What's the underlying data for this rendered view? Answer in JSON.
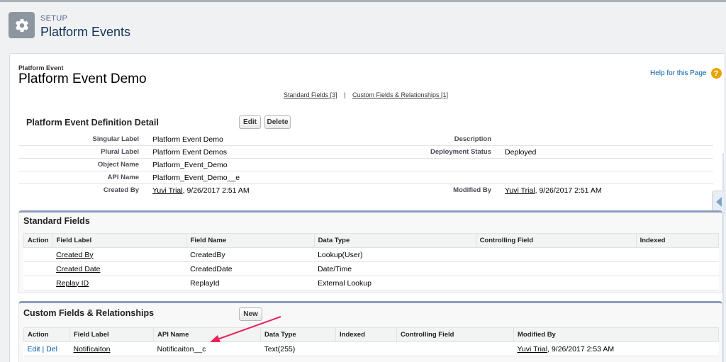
{
  "header": {
    "kicker": "SETUP",
    "title": "Platform Events",
    "icon": "gear-icon"
  },
  "record": {
    "type_label": "Platform Event",
    "title": "Platform Event Demo",
    "help_label": "Help for this Page",
    "help_icon": "?"
  },
  "quicklinks": {
    "standard_fields": "Standard Fields",
    "standard_count": "[3]",
    "separator": "|",
    "custom_fields": "Custom Fields & Relationships",
    "custom_count": "[1]"
  },
  "detail": {
    "title": "Platform Event Definition Detail",
    "edit_label": "Edit",
    "delete_label": "Delete",
    "singular_label_label": "Singular Label",
    "singular_label_value": "Platform Event Demo",
    "plural_label_label": "Plural Label",
    "plural_label_value": "Platform Event Demos",
    "object_name_label": "Object Name",
    "object_name_value": "Platform_Event_Demo",
    "api_name_label": "API Name",
    "api_name_value": "Platform_Event_Demo__e",
    "created_by_label": "Created By",
    "created_by_user": "Yuvi Trial",
    "created_by_date": ", 9/26/2017 2:51 AM",
    "description_label": "Description",
    "description_value": "",
    "deployment_status_label": "Deployment Status",
    "deployment_status_value": "Deployed",
    "modified_by_label": "Modified By",
    "modified_by_user": "Yuvi Trial",
    "modified_by_date": ", 9/26/2017 2:51 AM"
  },
  "standard_fields": {
    "title": "Standard Fields",
    "columns": [
      "Action",
      "Field Label",
      "Field Name",
      "Data Type",
      "Controlling Field",
      "Indexed"
    ],
    "rows": [
      {
        "field_label": "Created By",
        "field_name": "CreatedBy",
        "data_type": "Lookup(User)"
      },
      {
        "field_label": "Created Date",
        "field_name": "CreatedDate",
        "data_type": "Date/Time"
      },
      {
        "field_label": "Replay ID",
        "field_name": "ReplayId",
        "data_type": "External Lookup"
      }
    ]
  },
  "custom_fields": {
    "title": "Custom Fields & Relationships",
    "new_label": "New",
    "columns": [
      "Action",
      "Field Label",
      "API Name",
      "Data Type",
      "Indexed",
      "Controlling Field",
      "Modified By"
    ],
    "rows": [
      {
        "edit": "Edit",
        "sep": " | ",
        "del": "Del",
        "field_label": "Notificaiton",
        "api_name": "Notificaiton__c",
        "data_type": "Text(255)",
        "modified_user": "Yuvi Trial",
        "modified_date": ", 9/26/2017 2:53 AM"
      }
    ]
  },
  "colors": {
    "section_border": "#8e9dbe",
    "link_blue": "#015ba7",
    "arrow": "#e8245a",
    "help_icon": "#e8a300"
  }
}
